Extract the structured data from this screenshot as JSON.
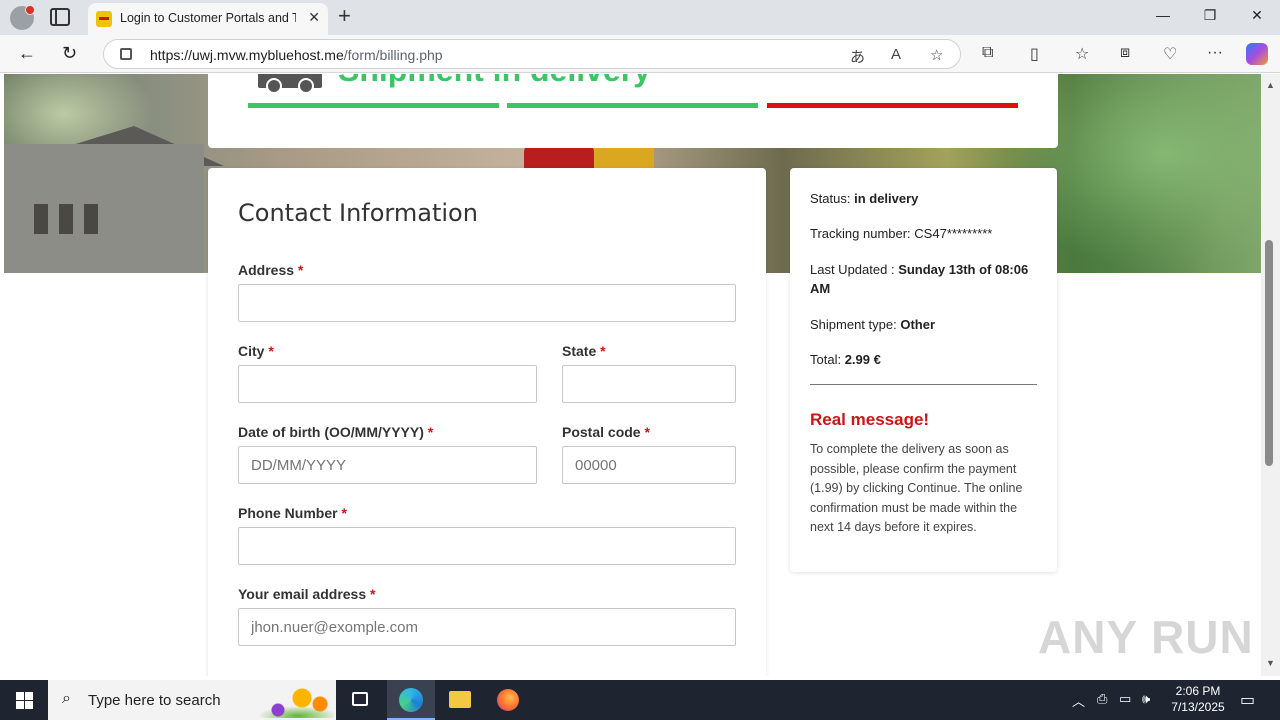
{
  "browser": {
    "tab_title": "Login to Customer Portals and To",
    "url_host": "https://uwj.mvw.mybluehost.me",
    "url_path": "/form/billing.php"
  },
  "page": {
    "shipment_title": "Shipment in delivery",
    "progress_colors": [
      "#3cc565",
      "#3cc565",
      "#e00e0e"
    ],
    "form_title": "Contact Information",
    "fields": {
      "address": {
        "label": "Address",
        "required": "*",
        "placeholder": ""
      },
      "city": {
        "label": "City",
        "required": "*",
        "placeholder": ""
      },
      "state": {
        "label": "State",
        "required": "*",
        "placeholder": ""
      },
      "dob": {
        "label": "Date of birth (OO/MM/YYYY)",
        "required": "*",
        "placeholder": "DD/MM/YYYY"
      },
      "postal": {
        "label": "Postal code",
        "required": "*",
        "placeholder": "00000"
      },
      "phone": {
        "label": "Phone Number",
        "required": "*",
        "placeholder": ""
      },
      "email": {
        "label": "Your email address",
        "required": "*",
        "placeholder": "jhon.nuer@exomple.com"
      }
    },
    "summary": {
      "status_label": "Status:",
      "status_value": "in delivery",
      "tracking_label": "Tracking number:",
      "tracking_value": "CS47*********",
      "updated_label": "Last Updated :",
      "updated_value": "Sunday 13th of 08:06 AM",
      "type_label": "Shipment type:",
      "type_value": "Other",
      "total_label": "Total:",
      "total_value": "2.99 €",
      "real_title": "Real message!",
      "real_message": "To complete the delivery as soon as possible, please confirm the payment (1.99) by clicking Continue. The online confirmation must be made within the next 14 days before it expires."
    }
  },
  "watermark": "ANY RUN",
  "taskbar": {
    "search_placeholder": "Type here to search",
    "time": "2:06 PM",
    "date": "7/13/2025"
  },
  "accent_green": "#3cc565",
  "accent_red": "#d01414"
}
